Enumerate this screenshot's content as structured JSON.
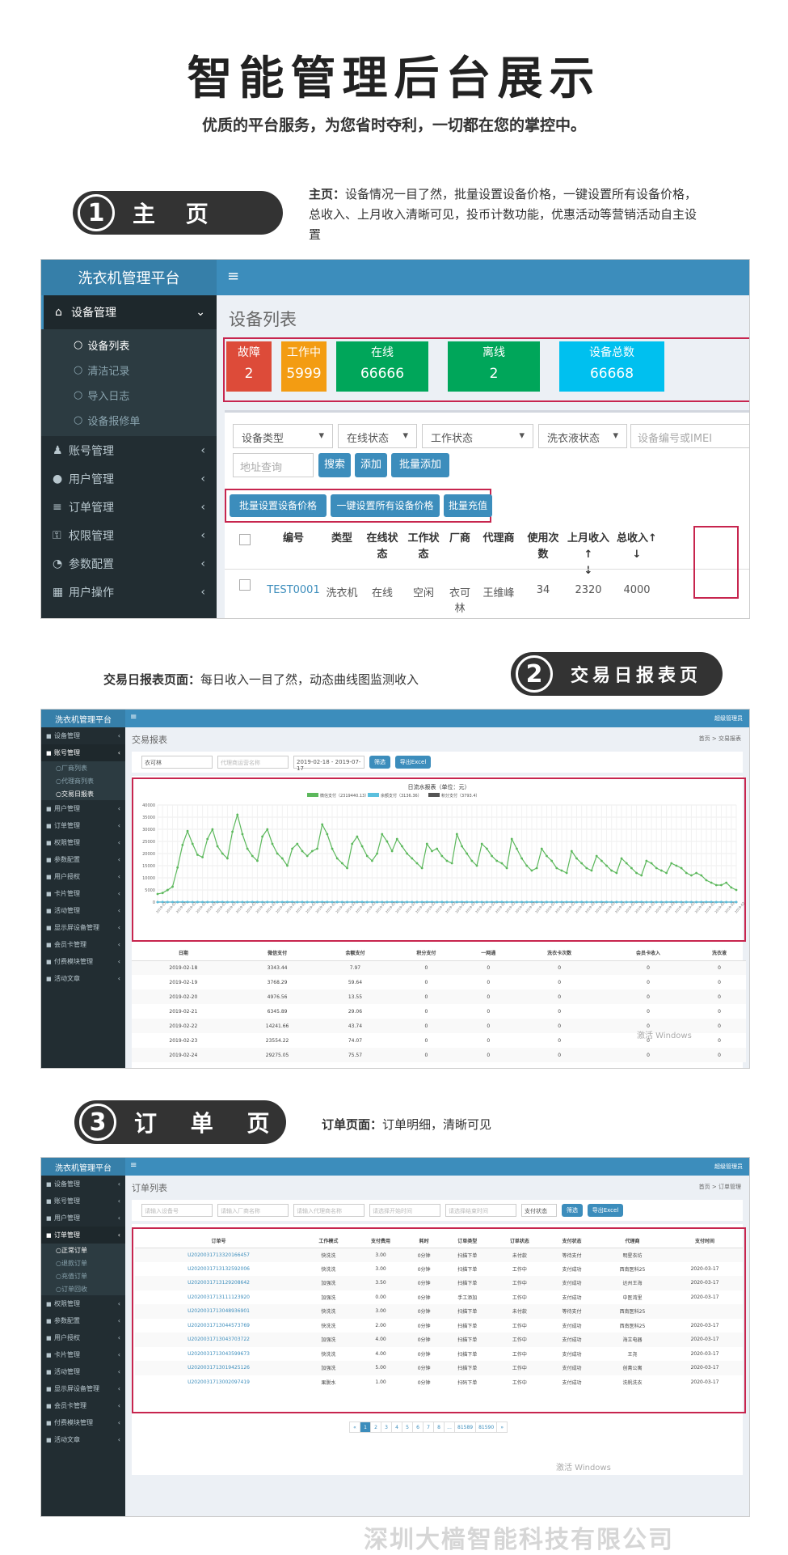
{
  "hero": {
    "title": "智能管理后台展示",
    "subtitle": "优质的平台服务，为您省时夺利，一切都在您的掌控中。"
  },
  "section1": {
    "pill_num": "1",
    "pill_text": "主 页",
    "desc_label": "主页：",
    "desc": "设备情况一目了然，批量设置设备价格，一键设置所有设备价格，总收入、上月收入清晰可见，投币计数功能，优惠活动等营销活动自主设置",
    "app": {
      "brand": "洗衣机管理平台",
      "menu_icon": "≡",
      "sidebar": [
        {
          "label": "设备管理",
          "icon": "home-icon",
          "open": true
        },
        {
          "label": "账号管理",
          "icon": "users-icon"
        },
        {
          "label": "用户管理",
          "icon": "user-icon"
        },
        {
          "label": "订单管理",
          "icon": "list-icon"
        },
        {
          "label": "权限管理",
          "icon": "key-icon"
        },
        {
          "label": "参数配置",
          "icon": "gauge-icon"
        },
        {
          "label": "用户操作",
          "icon": "chart-icon"
        }
      ],
      "subitems": [
        "设备列表",
        "清洁记录",
        "导入日志",
        "设备报修单"
      ],
      "page_title": "设备列表",
      "stats": [
        {
          "label": "故障",
          "value": "2",
          "color": "#dd4b39"
        },
        {
          "label": "工作中",
          "value": "5999",
          "color": "#f39c12"
        },
        {
          "label": "在线",
          "value": "66666",
          "color": "#00a65a"
        },
        {
          "label": "离线",
          "value": "2",
          "color": "#00a65a"
        },
        {
          "label": "设备总数",
          "value": "66668",
          "color": "#00c0ef"
        }
      ],
      "filters": [
        "设备类型",
        "在线状态",
        "工作状态",
        "洗衣液状态"
      ],
      "imei_placeholder": "设备编号或IMEI",
      "addr_placeholder": "地址查询",
      "buttons": [
        "搜索",
        "添加",
        "批量添加"
      ],
      "batch_buttons": [
        "批量设置设备价格",
        "一键设置所有设备价格",
        "批量充值"
      ],
      "columns": [
        "编号",
        "类型",
        "在线状\n态",
        "工作状\n态",
        "厂商",
        "代理商",
        "使用次\n数",
        "上月收入↑\n↓",
        "总收入↑\n↓"
      ],
      "row": [
        "TEST0001",
        "洗衣机",
        "在线",
        "空闲",
        "衣可林",
        "王维峰",
        "34",
        "2320",
        "4000"
      ]
    }
  },
  "section2": {
    "pill_num": "2",
    "pill_text": "交易日报表页",
    "desc_label": "交易日报表页面：",
    "desc": "每日收入一目了然，动态曲线图监测收入",
    "app": {
      "brand": "洗衣机管理平台",
      "top_right": "超级管理员",
      "page_title": "交易报表",
      "breadcrumb": "首页 > 交易报表",
      "sidebar": [
        "设备管理",
        "账号管理",
        "用户管理",
        "订单管理",
        "权限管理",
        "参数配置",
        "用户授权",
        "卡片管理",
        "活动管理",
        "显示屏设备管理",
        "会员卡管理",
        "付费模块管理",
        "活动文章"
      ],
      "subitems": [
        "厂商列表",
        "代理商列表",
        "交易日报表"
      ],
      "filter_value": "衣可林",
      "filter_placeholder": "代理商运营名称",
      "date_range": "2019-02-18 - 2019-07-17",
      "buttons": [
        "筛选",
        "导出Excel"
      ],
      "table_headers": [
        "日期",
        "微信支付",
        "余额支付",
        "积分支付",
        "一网通",
        "洗衣卡次数",
        "会员卡收入",
        "洗衣液"
      ],
      "table_rows": [
        [
          "2019-02-18",
          "3343.44",
          "7.97",
          "0",
          "0",
          "0",
          "0",
          "0"
        ],
        [
          "2019-02-19",
          "3768.29",
          "59.64",
          "0",
          "0",
          "0",
          "0",
          "0"
        ],
        [
          "2019-02-20",
          "4976.56",
          "13.55",
          "0",
          "0",
          "0",
          "0",
          "0"
        ],
        [
          "2019-02-21",
          "6345.89",
          "29.06",
          "0",
          "0",
          "0",
          "0",
          "0"
        ],
        [
          "2019-02-22",
          "14241.66",
          "43.74",
          "0",
          "0",
          "0",
          "0",
          "0"
        ],
        [
          "2019-02-23",
          "23554.22",
          "74.07",
          "0",
          "0",
          "0",
          "0",
          "0"
        ],
        [
          "2019-02-24",
          "29275.05",
          "75.57",
          "0",
          "0",
          "0",
          "0",
          "0"
        ]
      ],
      "watermark": "激活 Windows"
    }
  },
  "chart_data": {
    "type": "line",
    "title": "日流水报表（单位：元）",
    "ylim": [
      0,
      40000
    ],
    "yticks": [
      0,
      5000,
      10000,
      15000,
      20000,
      25000,
      30000,
      35000,
      40000
    ],
    "series": [
      {
        "name": "微信支付（2319440.13）",
        "color": "#5cb85c",
        "values": [
          3343,
          3768,
          4977,
          6346,
          14242,
          23554,
          29275,
          24000,
          19500,
          18500,
          26000,
          30000,
          23000,
          20000,
          18000,
          29000,
          36000,
          28000,
          22000,
          19000,
          17000,
          27000,
          30000,
          24000,
          20000,
          18000,
          15000,
          22000,
          24000,
          21000,
          19000,
          21000,
          22000,
          32000,
          28000,
          22000,
          18000,
          16000,
          14000,
          24000,
          27000,
          23000,
          19000,
          17000,
          20000,
          28000,
          25000,
          21000,
          26000,
          23000,
          20000,
          18000,
          16000,
          14000,
          24000,
          21000,
          22000,
          19000,
          17000,
          16000,
          28000,
          23000,
          20000,
          17000,
          15000,
          24000,
          22000,
          19000,
          17000,
          16000,
          14000,
          26000,
          22000,
          18000,
          15000,
          13000,
          14000,
          22000,
          19000,
          17000,
          14000,
          13000,
          12000,
          21000,
          18000,
          16000,
          14000,
          13000,
          19000,
          17000,
          15000,
          13000,
          12000,
          18000,
          16000,
          14000,
          12000,
          11000,
          17000,
          16000,
          14000,
          13000,
          12000,
          16000,
          15000,
          14000,
          12000,
          11000,
          12000,
          11000,
          9000,
          8000,
          7000,
          7000,
          8000,
          6000,
          5000
        ]
      },
      {
        "name": "余额支付（3136.36）",
        "color": "#5bc0de",
        "values": [
          8,
          60,
          14,
          29,
          44,
          74,
          76
        ]
      },
      {
        "name": "积分支付（3793.4）",
        "color": "#555555",
        "values": [
          0,
          0,
          0,
          0,
          0,
          0,
          0
        ]
      }
    ]
  },
  "section3": {
    "pill_num": "3",
    "pill_text": "订 单 页",
    "desc_label": "订单页面：",
    "desc": "订单明细，清晰可见",
    "app": {
      "brand": "洗衣机管理平台",
      "top_right": "超级管理员",
      "page_title": "订单列表",
      "breadcrumb": "首页 > 订单管理",
      "sidebar": [
        "设备管理",
        "账号管理",
        "用户管理",
        "订单管理",
        "权限管理",
        "参数配置",
        "用户授权",
        "卡片管理",
        "活动管理",
        "显示屏设备管理",
        "会员卡管理",
        "付费模块管理",
        "活动文章"
      ],
      "subitems": [
        "正常订单",
        "退款订单",
        "充值订单",
        "订单回收"
      ],
      "filter_placeholders": [
        "请输入设备号",
        "请输入厂商名称",
        "请输入代理商名称",
        "请选择开始时间",
        "请选择结束时间"
      ],
      "pay_status": "支付状态",
      "buttons": [
        "筛选",
        "导出Excel"
      ],
      "headers": [
        "订单号",
        "工作模式",
        "支付费用",
        "耗时",
        "订单类型",
        "订单状态",
        "支付状态",
        "代理商",
        "支付时间"
      ],
      "rows": [
        [
          "U2020031713320166457",
          "快洗洗",
          "3.00",
          "0分钟",
          "扫描下单",
          "未付款",
          "等待支付",
          "明星衣坊",
          ""
        ],
        [
          "U2020031713132592006",
          "快洗洗",
          "3.00",
          "0分钟",
          "扫描下单",
          "工作中",
          "支付成功",
          "西南医科25",
          "2020-03-17"
        ],
        [
          "U2020031713129208642",
          "加强洗",
          "3.50",
          "0分钟",
          "扫描下单",
          "工作中",
          "支付成功",
          "达州王海",
          "2020-03-17"
        ],
        [
          "U2020031713111123920",
          "加强洗",
          "0.00",
          "0分钟",
          "手工添加",
          "工作中",
          "支付成功",
          "中医湾里",
          "2020-03-17"
        ],
        [
          "U2020031713048936901",
          "快洗洗",
          "3.00",
          "0分钟",
          "扫描下单",
          "未付款",
          "等待支付",
          "西南医科25",
          ""
        ],
        [
          "U2020031713044573769",
          "快洗洗",
          "2.00",
          "0分钟",
          "扫描下单",
          "工作中",
          "支付成功",
          "西南医科25",
          "2020-03-17"
        ],
        [
          "U2020031713043703722",
          "加强洗",
          "4.00",
          "0分钟",
          "扫描下单",
          "工作中",
          "支付成功",
          "海立电器",
          "2020-03-17"
        ],
        [
          "U2020031713043599673",
          "快洗洗",
          "4.00",
          "0分钟",
          "扫描下单",
          "工作中",
          "支付成功",
          "王尧",
          "2020-03-17"
        ],
        [
          "U2020031713019425126",
          "加强洗",
          "5.00",
          "0分钟",
          "扫描下单",
          "工作中",
          "支付成功",
          "创菁公寓",
          "2020-03-17"
        ],
        [
          "U2020031713002097419",
          "果脱水",
          "1.00",
          "0分钟",
          "扫码下单",
          "工作中",
          "支付成功",
          "洗帆洗衣",
          "2020-03-17"
        ]
      ],
      "pagination": [
        "«",
        "1",
        "2",
        "3",
        "4",
        "5",
        "6",
        "7",
        "8",
        "...",
        "81589",
        "81590",
        "»"
      ],
      "watermark": "激活 Windows"
    }
  },
  "footer": {
    "company": "深圳大樯智能科技有限公司"
  }
}
